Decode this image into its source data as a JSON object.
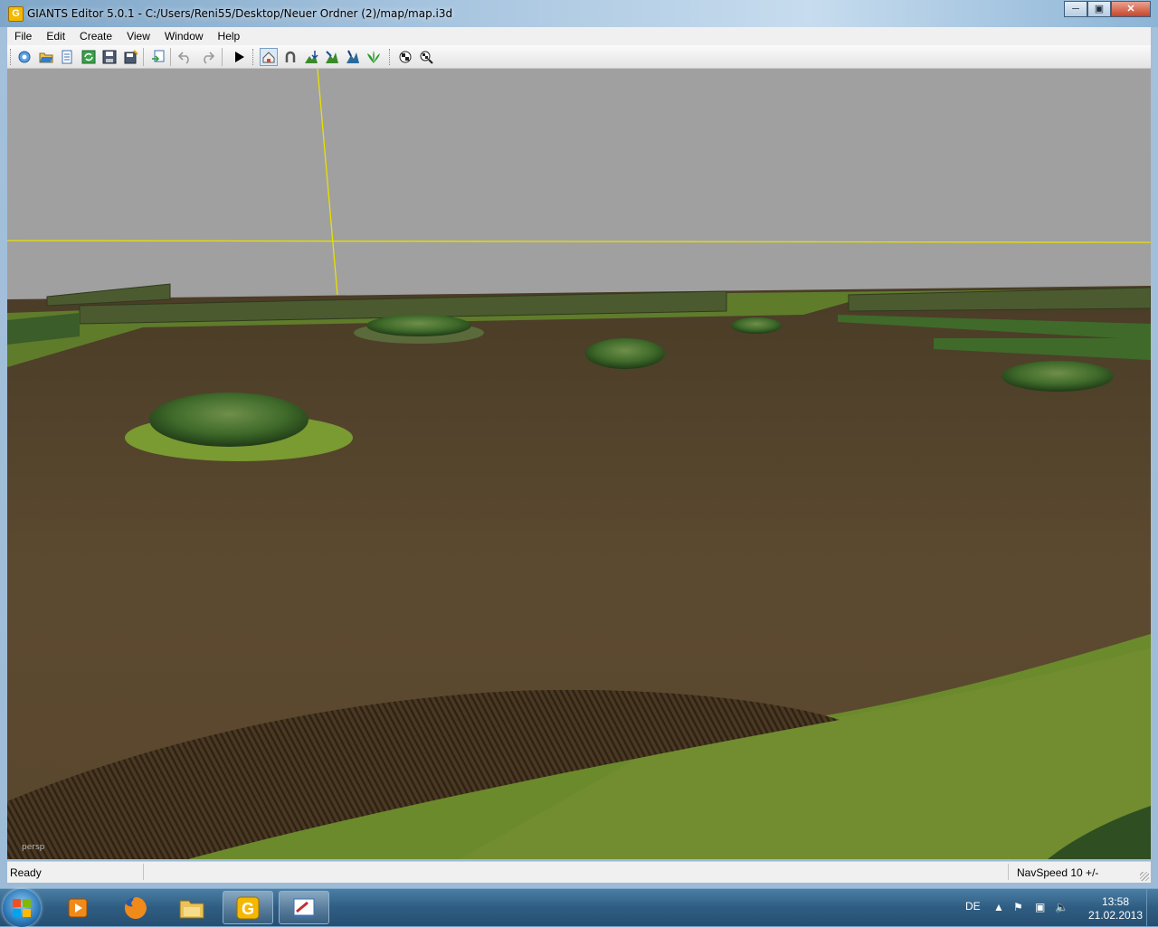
{
  "window": {
    "title": "GIANTS Editor 5.0.1 - C:/Users/Reni55/Desktop/Neuer Ordner (2)/map/map.i3d",
    "app_icon_letter": "G",
    "controls": [
      "minimize",
      "maximize",
      "close"
    ]
  },
  "menubar": {
    "items": [
      {
        "label": "File"
      },
      {
        "label": "Edit"
      },
      {
        "label": "Create"
      },
      {
        "label": "View"
      },
      {
        "label": "Window"
      },
      {
        "label": "Help"
      }
    ]
  },
  "toolbar": {
    "buttons": [
      {
        "icon": "new-scene-icon"
      },
      {
        "icon": "open-folder-icon"
      },
      {
        "icon": "document-list-icon"
      },
      {
        "icon": "refresh-icon"
      },
      {
        "icon": "save-icon"
      },
      {
        "icon": "save-all-icon"
      },
      {
        "icon": "import-icon"
      },
      {
        "icon": "undo-icon"
      },
      {
        "icon": "redo-icon"
      },
      {
        "icon": "play-icon"
      },
      {
        "icon": "select-mode-icon",
        "active": true
      },
      {
        "icon": "magnet-icon"
      },
      {
        "icon": "terrain-sculpt-icon"
      },
      {
        "icon": "terrain-paint-icon"
      },
      {
        "icon": "terrain-detail-icon"
      },
      {
        "icon": "foliage-paint-icon"
      },
      {
        "icon": "checker-texture-icon"
      },
      {
        "icon": "checker-search-icon"
      }
    ]
  },
  "viewport": {
    "label": "persp",
    "colors": {
      "sky": "#a0a0a0",
      "soil": "#5b4a30",
      "grass": "#6d8a2d",
      "axis": "#e8e000"
    }
  },
  "statusbar": {
    "left": "Ready",
    "right": "NavSpeed 10 +/-"
  },
  "taskbar": {
    "apps": [
      {
        "name": "media-player-icon"
      },
      {
        "name": "firefox-icon"
      },
      {
        "name": "explorer-folder-icon"
      },
      {
        "name": "giants-editor-icon",
        "open": true
      },
      {
        "name": "paint-tool-icon",
        "open": true
      }
    ],
    "tray": {
      "language": "DE",
      "time": "13:58",
      "date": "21.02.2013"
    }
  }
}
